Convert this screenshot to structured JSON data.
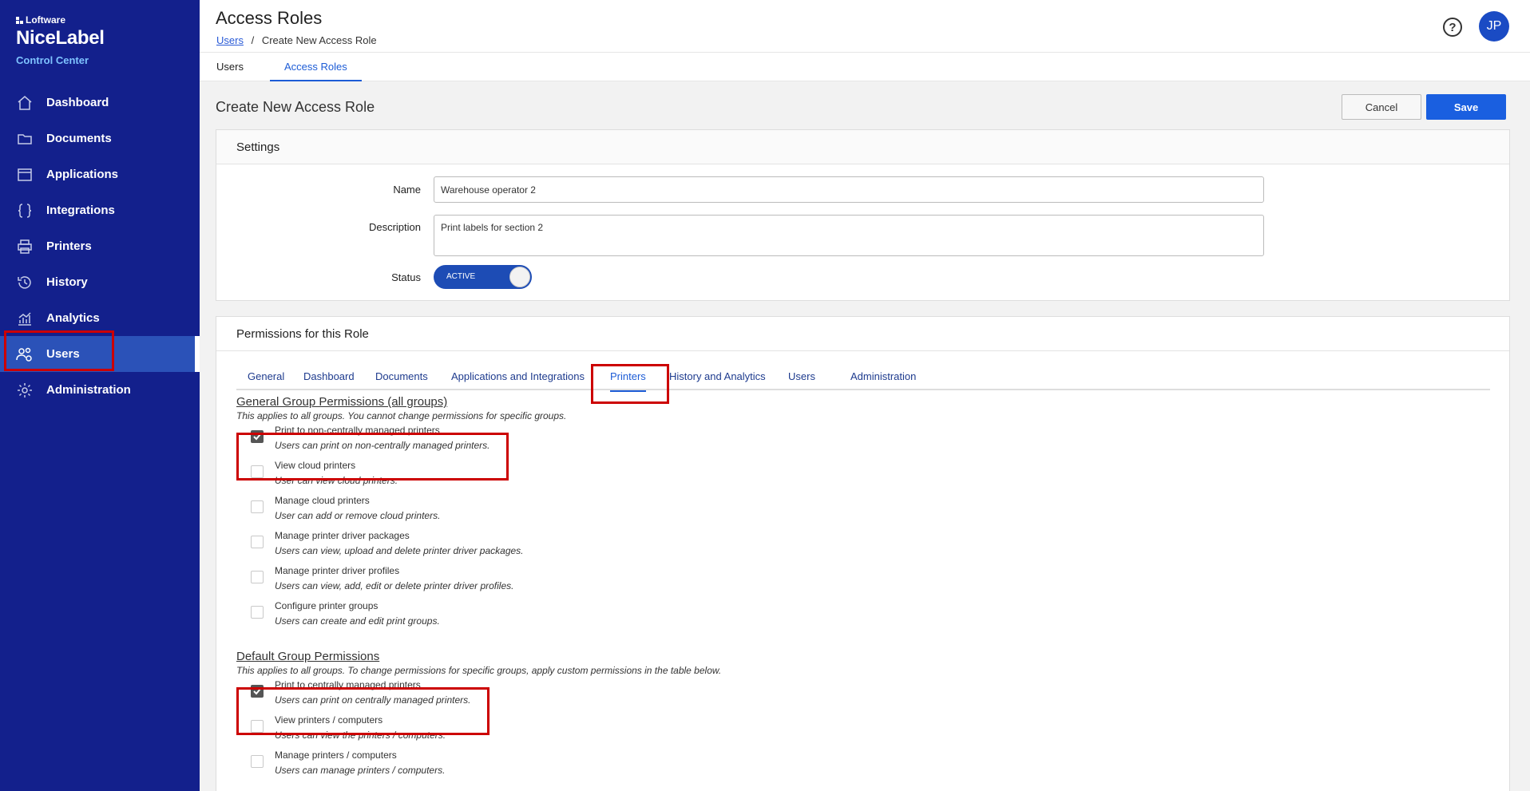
{
  "brand": {
    "company": "Loftware",
    "product": "NiceLabel",
    "subtitle": "Control Center"
  },
  "sidebar": {
    "items": [
      {
        "label": "Dashboard",
        "icon": "home-icon"
      },
      {
        "label": "Documents",
        "icon": "folder-icon"
      },
      {
        "label": "Applications",
        "icon": "window-icon"
      },
      {
        "label": "Integrations",
        "icon": "braces-icon"
      },
      {
        "label": "Printers",
        "icon": "printer-icon"
      },
      {
        "label": "History",
        "icon": "history-icon"
      },
      {
        "label": "Analytics",
        "icon": "analytics-icon"
      },
      {
        "label": "Users",
        "icon": "users-icon",
        "active": true
      },
      {
        "label": "Administration",
        "icon": "gear-icon"
      }
    ]
  },
  "header": {
    "title": "Access Roles",
    "breadcrumb": {
      "link": "Users",
      "separator": "/",
      "current": "Create New Access Role"
    },
    "help_icon": "?",
    "avatar_initials": "JP"
  },
  "topnav": {
    "tabs": [
      {
        "label": "Users"
      },
      {
        "label": "Access Roles",
        "active": true
      }
    ]
  },
  "content": {
    "title": "Create New Access Role",
    "cancel_label": "Cancel",
    "save_label": "Save"
  },
  "settings": {
    "heading": "Settings",
    "name_label": "Name",
    "name_value": "Warehouse operator 2",
    "description_label": "Description",
    "description_value": "Print labels for section 2",
    "status_label": "Status",
    "status_value": "ACTIVE"
  },
  "permissions": {
    "heading": "Permissions for this Role",
    "tabs": [
      {
        "label": "General"
      },
      {
        "label": "Dashboard"
      },
      {
        "label": "Documents"
      },
      {
        "label": "Applications and Integrations"
      },
      {
        "label": "Printers",
        "active": true
      },
      {
        "label": "History and Analytics"
      },
      {
        "label": "Users"
      },
      {
        "label": "Administration"
      }
    ],
    "general_group": {
      "title": "General Group Permissions (all groups)",
      "note": "This applies to all groups. You cannot change permissions for specific groups.",
      "items": [
        {
          "title": "Print to non-centrally managed printers",
          "desc": "Users can print on non-centrally managed printers.",
          "checked": true
        },
        {
          "title": "View cloud printers",
          "desc": "User can view cloud printers.",
          "checked": false
        },
        {
          "title": "Manage cloud printers",
          "desc": "User can add or remove cloud printers.",
          "checked": false
        },
        {
          "title": "Manage printer driver packages",
          "desc": "Users can view, upload and delete printer driver packages.",
          "checked": false
        },
        {
          "title": "Manage printer driver profiles",
          "desc": "Users can view, add, edit or delete printer driver profiles.",
          "checked": false
        },
        {
          "title": "Configure printer groups",
          "desc": "Users can create and edit print groups.",
          "checked": false
        }
      ]
    },
    "default_group": {
      "title": "Default Group Permissions",
      "note": "This applies to all groups. To change permissions for specific groups, apply custom permissions in the table below.",
      "items": [
        {
          "title": "Print to centrally managed printers",
          "desc": "Users can print on centrally managed printers.",
          "checked": true
        },
        {
          "title": "View printers / computers",
          "desc": "Users can view the printers / computers.",
          "checked": false
        },
        {
          "title": "Manage printers / computers",
          "desc": "Users can manage printers / computers.",
          "checked": false
        }
      ]
    }
  }
}
